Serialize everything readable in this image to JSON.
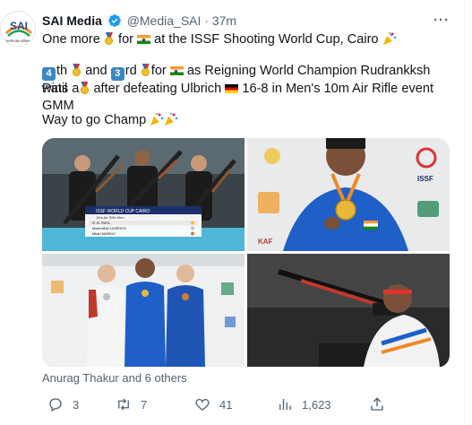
{
  "tweet": {
    "author_name": "SAI Media",
    "handle": "@Media_SAI",
    "separator": "·",
    "time": "37m",
    "line1_a": "One more",
    "line1_b": "for",
    "line1_c": "at the ISSF Shooting World Cup, Cairo",
    "line2_a": "th",
    "line2_num1": "4",
    "line2_b": "and",
    "line2_num2": "3",
    "line2_c": "rd",
    "line2_d": "for",
    "line2_e": "as Reigning World Champion Rudrankksh Patil",
    "line3_a": "wins a",
    "line3_b": "after defeating Ulbrich",
    "line3_c": "16-8 in Men's 10m Air Rifle event GMM",
    "line4": "Way to go Champ",
    "likers": "Anurag Thakur and 6 others"
  },
  "avatar": {
    "logo_text": "SAI",
    "sub_text": "भारतीय खेल प्राधिकरण"
  },
  "scoreboard": {
    "title": "ISSF WORLD CUP CAIRO",
    "event": "10m Air Rifle Men",
    "rows": [
      {
        "name": "R. B. PATIL"
      },
      {
        "name": "Maximilian ULBRICH"
      },
      {
        "name": "Milan MARKIC"
      }
    ]
  },
  "banner": {
    "issf": "ISSF",
    "kaf": "KAF"
  },
  "actions": {
    "replies": "3",
    "retweets": "7",
    "likes": "41",
    "views": "1,623"
  },
  "colors": {
    "accent": "#1d9bf0",
    "muted": "#536471",
    "india_blue": "#1e5fc8"
  }
}
